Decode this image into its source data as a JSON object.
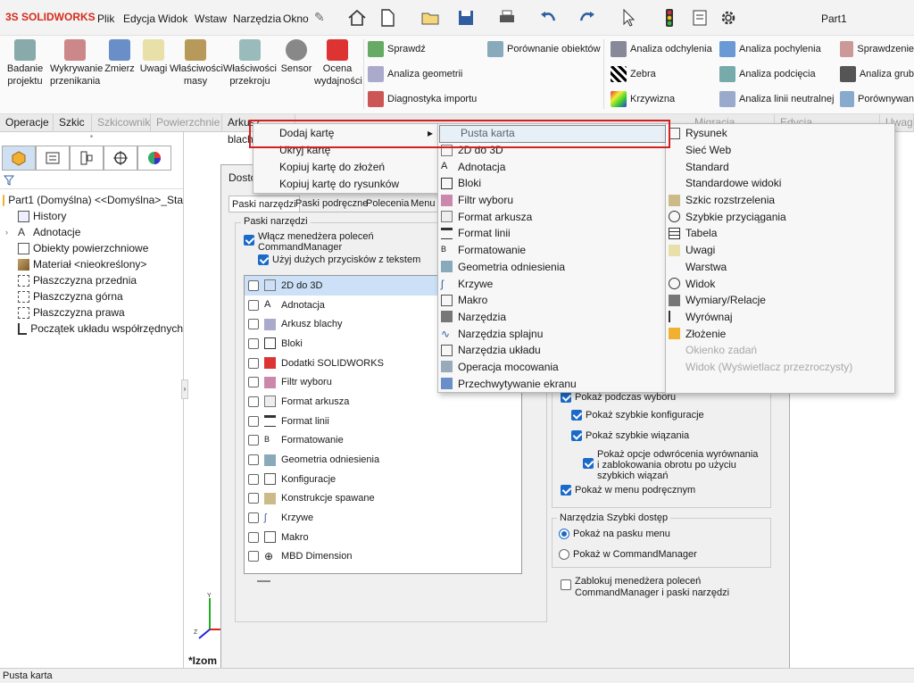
{
  "app": {
    "logo": "SOLIDWORKS",
    "doc_title": "Part1"
  },
  "menubar": [
    "Plik",
    "Edycja",
    "Widok",
    "Wstaw",
    "Narzędzia",
    "Okno"
  ],
  "ribbon": {
    "big": [
      {
        "label": "Badanie projektu",
        "icon": "study-icon"
      },
      {
        "label": "Wykrywanie przenikania",
        "icon": "interference-icon"
      },
      {
        "label": "Zmierz",
        "icon": "measure-icon"
      },
      {
        "label": "Uwagi",
        "icon": "markup-icon"
      },
      {
        "label": "Właściwości masy",
        "icon": "mass-properties-icon"
      },
      {
        "label": "Właściwości przekroju",
        "icon": "section-properties-icon"
      },
      {
        "label": "Sensor",
        "icon": "sensor-icon"
      },
      {
        "label": "Ocena wydajności",
        "icon": "performance-icon"
      }
    ],
    "small_col1": [
      "Sprawdź",
      "Analiza geometrii",
      "Diagnostyka importu"
    ],
    "small_col2": [
      "Porównanie obiektów"
    ],
    "small_col3": [
      "Analiza odchylenia",
      "Zebra",
      "Krzywizna"
    ],
    "small_col4": [
      "Analiza pochylenia",
      "Analiza podcięcia",
      "Analiza linii neutralnej"
    ],
    "small_col5": [
      "Sprawdzenie",
      "Analiza grub",
      "Porównywan"
    ]
  },
  "tabs": [
    {
      "label": "Operacje",
      "state": "normal"
    },
    {
      "label": "Szkic",
      "state": "normal"
    },
    {
      "label": "Szkicownik",
      "state": "dim"
    },
    {
      "label": "Powierzchnie",
      "state": "dim"
    },
    {
      "label": "Arkusz blachy",
      "state": "normal"
    },
    {
      "label": "Migracja danych",
      "state": "dim"
    },
    {
      "label": "Edycja bezpośrednia",
      "state": "dim"
    },
    {
      "label": "Uwagi",
      "state": "dim"
    }
  ],
  "tree": {
    "root": "Part1 (Domyślna) <<Domyślna>_Sta",
    "items": [
      "History",
      "Adnotacje",
      "Obiekty powierzchniowe",
      "Materiał <nieokreślony>",
      "Płaszczyzna przednia",
      "Płaszczyzna górna",
      "Płaszczyzna prawa",
      "Początek układu współrzędnych"
    ]
  },
  "context_menu": {
    "items": [
      "Dodaj kartę",
      "Ukryj kartę",
      "Kopiuj kartę do złożeń",
      "Kopiuj kartę do rysunków"
    ],
    "arrow": "▸"
  },
  "submenu1": [
    "Pusta karta",
    "2D do 3D",
    "Adnotacja",
    "Bloki",
    "Filtr wyboru",
    "Format arkusza",
    "Format linii",
    "Formatowanie",
    "Geometria odniesienia",
    "Krzywe",
    "Makro",
    "Narzędzia",
    "Narzędzia splajnu",
    "Narzędzia układu",
    "Operacja mocowania",
    "Przechwytywanie ekranu"
  ],
  "submenu2": [
    {
      "label": "Rysunek",
      "disabled": false
    },
    {
      "label": "Sieć Web",
      "disabled": false
    },
    {
      "label": "Standard",
      "disabled": false
    },
    {
      "label": "Standardowe widoki",
      "disabled": false
    },
    {
      "label": "Szkic rozstrzelenia",
      "disabled": false
    },
    {
      "label": "Szybkie przyciągania",
      "disabled": false
    },
    {
      "label": "Tabela",
      "disabled": false
    },
    {
      "label": "Uwagi",
      "disabled": false
    },
    {
      "label": "Warstwa",
      "disabled": false
    },
    {
      "label": "Widok",
      "disabled": false
    },
    {
      "label": "Wymiary/Relacje",
      "disabled": false
    },
    {
      "label": "Wyrównaj",
      "disabled": false
    },
    {
      "label": "Złożenie",
      "disabled": false
    },
    {
      "label": "Okienko zadań",
      "disabled": true
    },
    {
      "label": "Widok (Wyświetlacz przezroczysty)",
      "disabled": true
    }
  ],
  "dialog": {
    "title": "Dosto",
    "tabs": [
      "Paski narzędzi",
      "Paski podręczne",
      "Polecenia",
      "Menu"
    ],
    "group_label": "Paski narzędzi",
    "enable_cm": "Włącz menedżera poleceń CommandManager",
    "large_buttons": "Użyj dużych przycisków z tekstem",
    "toolbars": [
      "2D do 3D",
      "Adnotacja",
      "Arkusz blachy",
      "Bloki",
      "Dodatki SOLIDWORKS",
      "Filtr wyboru",
      "Format arkusza",
      "Format linii",
      "Formatowanie",
      "Geometria odniesienia",
      "Konfiguracje",
      "Konstrukcje spawane",
      "Krzywe",
      "Makro",
      "MBD Dimension"
    ],
    "right": {
      "show_on_select": "Pokaż podczas wyboru",
      "quick_configs": "Pokaż szybkie konfiguracje",
      "quick_mates": "Pokaż szybkie wiązania",
      "flip_opts": "Pokaż opcje odwrócenia wyrównania i zablokowania obrotu po użyciu szybkich wiązań",
      "show_in_menu": "Pokaż w menu podręcznym",
      "qa_group": "Narzędzia Szybki dostęp",
      "qa_ribbon": "Pokaż na pasku menu",
      "qa_cm": "Pokaż w CommandManager",
      "lock": "Zablokuj menedżera poleceń CommandManager i paski narzędzi"
    }
  },
  "viewport": {
    "view_label": "*Izom"
  },
  "status": "Pusta karta",
  "colors": {
    "highlight_red": "#d42020",
    "accent": "#1b6ac9",
    "selected_row": "#cce1f7"
  }
}
